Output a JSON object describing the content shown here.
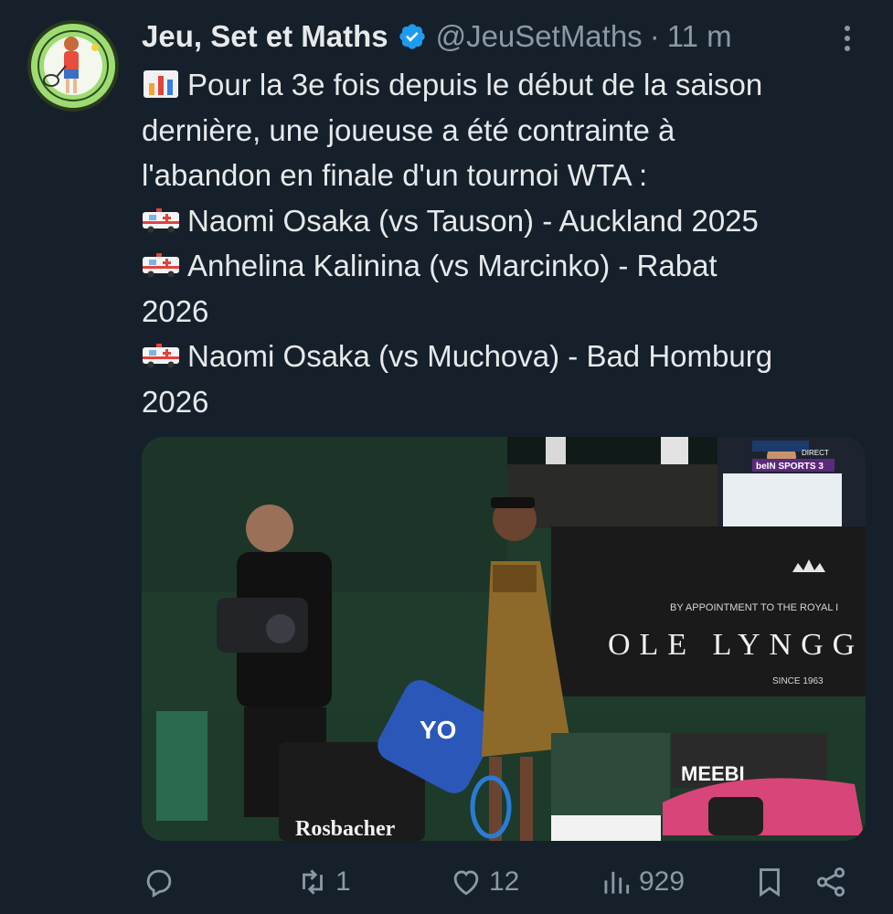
{
  "tweet": {
    "author_name": "Jeu, Set et Maths",
    "handle": "@JeuSetMaths",
    "separator": "·",
    "time": "11 m",
    "text_lines": [
      "Pour la 3e fois depuis le début de la saison",
      "dernière, une joueuse a été contrainte à",
      "l'abandon en finale d'un tournoi WTA :",
      "Naomi Osaka (vs Tauson) - Auckland 2025",
      "Anhelina Kalinina (vs Marcinko) - Rabat",
      "2026",
      "Naomi Osaka (vs Muchova) - Bad Homburg",
      "2026"
    ],
    "media": {
      "broadcast_label": "DIRECT",
      "channel_logo": "beIN SPORTS 3",
      "sponsor_line": "BY APPOINTMENT TO THE ROYAL I",
      "sponsor_name": "OLE LYNGG",
      "sponsor_since": "SINCE 1963",
      "bottle_brand": "Rosbacher",
      "bag_brand": "YO",
      "banner_brand": "MEEBI"
    }
  },
  "actions": {
    "reply_count": "",
    "retweet_count": "1",
    "like_count": "12",
    "views_count": "929"
  },
  "colors": {
    "background": "#15202b",
    "text": "#e7e9ea",
    "muted": "#8b98a5",
    "verified": "#1d9bf0"
  }
}
